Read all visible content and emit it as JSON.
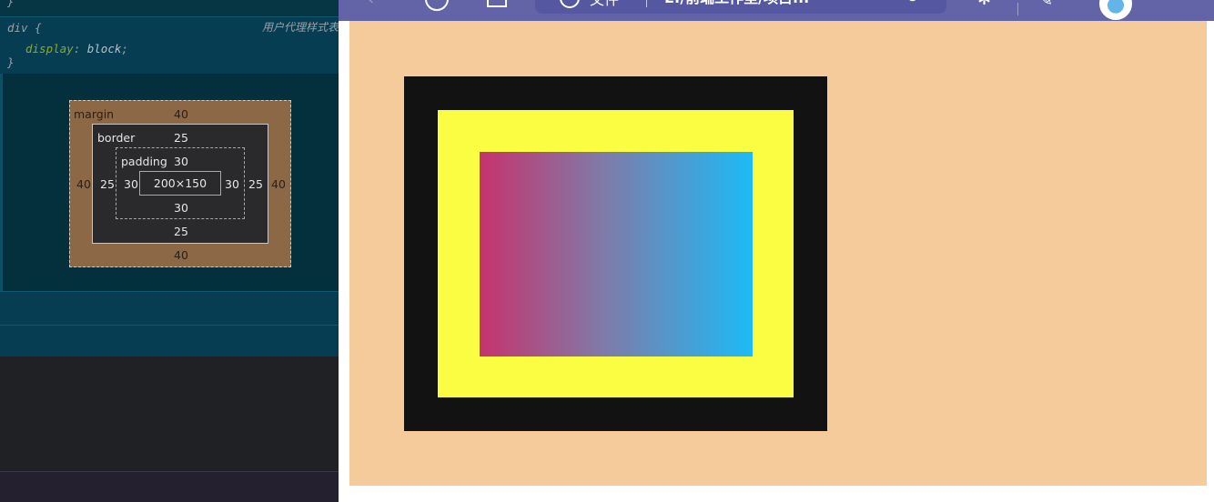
{
  "devtools": {
    "top_brace": "}",
    "rule": {
      "selector_open": "div {",
      "origin": "用户代理样式表",
      "property": "display",
      "colon": ":",
      "value": "block",
      "semicolon": ";",
      "close": "}"
    },
    "box_model": {
      "margin_label": "margin",
      "margin_top": "40",
      "margin_right": "40",
      "margin_bottom": "40",
      "margin_left": "40",
      "border_label": "border",
      "border_top": "25",
      "border_right": "25",
      "border_bottom": "25",
      "border_left": "25",
      "padding_label": "padding",
      "padding_top": "30",
      "padding_right": "30",
      "padding_bottom": "30",
      "padding_left": "30",
      "content_size": "200×150"
    }
  },
  "browser": {
    "toolbar_color": "#6264a7",
    "icons": [
      "back-arrow-icon",
      "reload-icon",
      "tab-grid-icon",
      "info-icon",
      "favorite-star-icon",
      "extension-icon",
      "puzzle-icon",
      "pen-icon",
      "profile-avatar"
    ],
    "address": {
      "file_label": "文件",
      "path": "E:/前端工作室/项目..."
    }
  },
  "page": {
    "background": "#f6cb9c",
    "div_border_color": "#121212",
    "div_padding_color": "#fbfd42",
    "content_gradient": [
      "#c6336d",
      "#1cbbf6"
    ]
  }
}
